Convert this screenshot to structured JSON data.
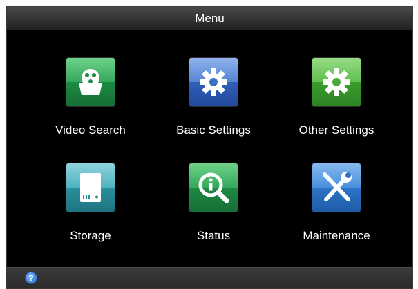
{
  "window": {
    "title": "Menu"
  },
  "menu": {
    "items": [
      {
        "label": "Video Search",
        "icon": "video-search-icon",
        "color": "#2f9a4f"
      },
      {
        "label": "Basic Settings",
        "icon": "gear-icon",
        "color": "#3f6fc0"
      },
      {
        "label": "Other Settings",
        "icon": "gear-icon",
        "color": "#4aa83e"
      },
      {
        "label": "Storage",
        "icon": "hard-drive-icon",
        "color": "#2e98a6"
      },
      {
        "label": "Status",
        "icon": "info-search-icon",
        "color": "#2f9a4f"
      },
      {
        "label": "Maintenance",
        "icon": "tools-icon",
        "color": "#2d74c7"
      }
    ]
  },
  "footer": {
    "help_icon": "help-icon",
    "help_color": "#2f78d6"
  }
}
